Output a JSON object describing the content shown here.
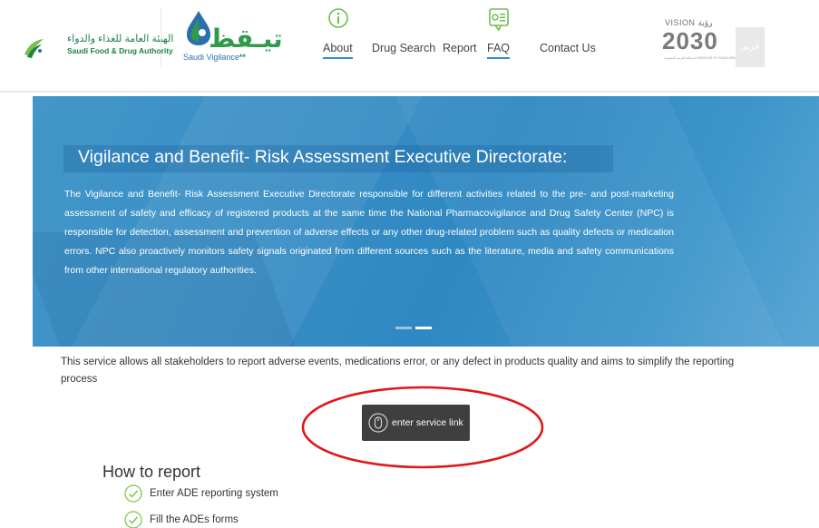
{
  "header": {
    "sfda_name_ar": "الهيئة العامة للغذاء والدواء",
    "sfda_name_en": "Saudi Food & Drug Authority",
    "app_name_ar": "تيـقظ",
    "app_name_en": "Saudi Vigilance",
    "nav": [
      {
        "label": "About",
        "icon": "info-icon",
        "active": true
      },
      {
        "label": "Drug Search"
      },
      {
        "label": "Report"
      },
      {
        "label": "FAQ",
        "icon": "faq-icon",
        "active": true
      },
      {
        "label": "Contact Us"
      }
    ],
    "vision_top": "VISION رؤية",
    "vision_year": "2030",
    "vision_sub": "المملكة العربية السعودية KINGDOM OF SAUDI ARABIA",
    "lang_toggle": "عربي"
  },
  "hero": {
    "title": "Vigilance and Benefit- Risk Assessment Executive Directorate:",
    "body": "The Vigilance and Benefit- Risk Assessment Executive Directorate responsible for different activities related to the pre- and post-marketing assessment of safety and efficacy of registered products at the same time the National Pharmacovigilance and Drug Safety Center (NPC) is responsible for detection, assessment and prevention of adverse effects or any other drug-related problem such as quality defects or medication errors. NPC also proactively monitors safety signals originated from different sources such as the literature, media and safety communications from other international regulatory authorities.",
    "slides": 2,
    "active_slide": 2
  },
  "main": {
    "intro": "This service allows all stakeholders to report adverse events, medications error, or any defect in products quality and aims to simplify the reporting process",
    "service_button": "enter service link",
    "how_to_title": "How to report",
    "steps": [
      {
        "label": "Enter ADE reporting system"
      },
      {
        "label": "Fill the ADEs forms"
      }
    ]
  },
  "colors": {
    "hero_blue": "#3a8fc6",
    "nav_active_underline": "#2f8dd0",
    "brand_green": "#2e9a4a",
    "annotation_red": "#e0161b",
    "service_button_bg": "#3f3f3f"
  }
}
